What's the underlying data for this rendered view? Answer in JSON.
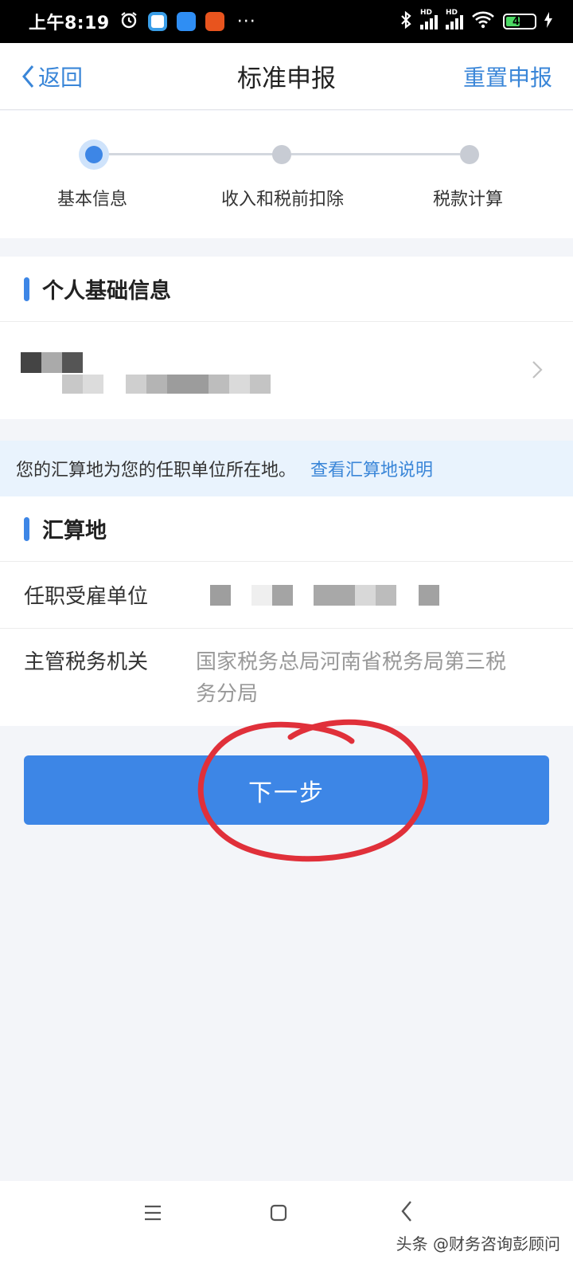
{
  "status_bar": {
    "time": "上午8:19",
    "more": "···",
    "battery": "44",
    "hd1": "HD",
    "hd2": "HD"
  },
  "nav": {
    "back_label": "返回",
    "title": "标准申报",
    "reset_label": "重置申报"
  },
  "steps": [
    {
      "label": "基本信息",
      "active": true
    },
    {
      "label": "收入和税前扣除",
      "active": false
    },
    {
      "label": "税款计算",
      "active": false
    }
  ],
  "personal": {
    "section_title": "个人基础信息"
  },
  "notice": {
    "text": "您的汇算地为您的任职单位所在地。",
    "link": "查看汇算地说明"
  },
  "settlement": {
    "section_title": "汇算地",
    "employer_label": "任职受雇单位",
    "tax_office_label": "主管税务机关",
    "tax_office_value": "国家税务总局河南省税务局第三税务分局"
  },
  "actions": {
    "next_label": "下一步"
  },
  "watermark": "头条 @财务咨询彭顾问",
  "colors": {
    "accent": "#3d86e6",
    "link": "#3a86d8",
    "annotation": "#e0303a"
  }
}
